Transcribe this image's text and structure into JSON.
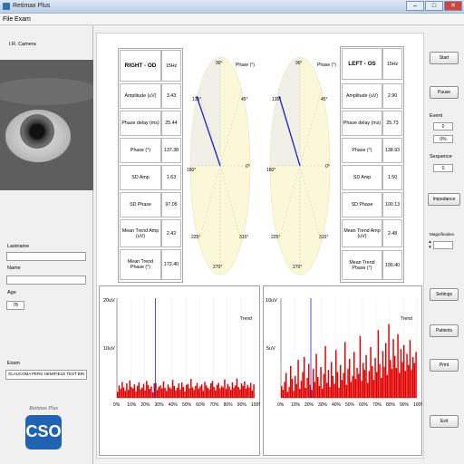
{
  "window": {
    "title": "Retimax Plus",
    "min": "–",
    "max": "□",
    "close": "✕"
  },
  "menu": [
    "File",
    "Exam"
  ],
  "left": {
    "camera_label": "I.R. Camera",
    "lastname_label": "Lastname",
    "lastname_value": "",
    "name_label": "Name",
    "name_value": "",
    "age_label": "Age",
    "age_value": "78",
    "exam_label": "Exam",
    "exam_value": "GLAUCOMA PERG HEMIFIELD TEST BIN",
    "brand": "Retimax Plus",
    "logo_text": "CSO"
  },
  "right_table": {
    "header_eye": "RIGHT - OD",
    "header_freq": "15Hz",
    "rows": [
      {
        "label": "Amplitude (uV)",
        "value": "3.43"
      },
      {
        "label": "Phase delay (ms)",
        "value": "25.44"
      },
      {
        "label": "Phase (°)",
        "value": "137.38"
      },
      {
        "label": "SD Amp",
        "value": "1.63"
      },
      {
        "label": "SD Phase",
        "value": "97.05"
      },
      {
        "label": "Mean Trend Amp (uV)",
        "value": "2.42"
      },
      {
        "label": "Mean Trend Phase (°)",
        "value": "172.40"
      }
    ]
  },
  "left_table": {
    "header_eye": "LEFT - OS",
    "header_freq": "15Hz",
    "rows": [
      {
        "label": "Amplitude (uV)",
        "value": "2.90"
      },
      {
        "label": "Phase delay (ms)",
        "value": "25.73"
      },
      {
        "label": "Phase (°)",
        "value": "138.93"
      },
      {
        "label": "SD Amp",
        "value": "1.50"
      },
      {
        "label": "SD Phase",
        "value": "100.13"
      },
      {
        "label": "Mean Trend Amp (uV)",
        "value": "2.48"
      },
      {
        "label": "Mean Trend Phase (°)",
        "value": "190.40"
      }
    ]
  },
  "polar_labels": {
    "title": "Phase (°)",
    "a90": "90°",
    "a45": "45°",
    "a0": "0°",
    "a315": "315°",
    "a270": "270°",
    "a225": "225°",
    "a180": "180°",
    "a135": "135°"
  },
  "buttons": {
    "start": "Start",
    "pause": "Pause",
    "impedance": "Impedance",
    "settings": "Settings",
    "patients": "Patients",
    "print": "Print",
    "exit": "Exit"
  },
  "status": {
    "event_label": "Event",
    "event_value": "0",
    "event_percent": "0%",
    "sequence_label": "Sequence",
    "sequence_value": "0",
    "magnification_label": "Magnification",
    "magnification_value": ""
  },
  "trend_labels": {
    "right": {
      "y_top": "20uV",
      "y_mid": "10uV",
      "trend": "Trend"
    },
    "left": {
      "y_top": "10uV",
      "y_mid": "5uV",
      "trend": "Trend"
    },
    "x_ticks": [
      "0%",
      "10%",
      "20%",
      "30%",
      "40%",
      "50%",
      "60%",
      "70%",
      "80%",
      "90%",
      "100%"
    ]
  },
  "colors": {
    "polar_fill": "#fbf8d8",
    "phase_vector": "#1a20c8",
    "trend_bar": "#e00000",
    "cursor": "#2222cc",
    "logo_blue": "#1f63b2"
  },
  "chart_data": [
    {
      "type": "polar",
      "name": "RIGHT - OD phase",
      "phase_deg": 137.38,
      "amplitude_uV": 3.43
    },
    {
      "type": "polar",
      "name": "LEFT - OS phase",
      "phase_deg": 138.93,
      "amplitude_uV": 2.9
    },
    {
      "type": "bar",
      "name": "RIGHT - OD trend",
      "x_range": [
        0,
        100
      ],
      "ylim": [
        0,
        20
      ],
      "cursor_x": 28,
      "values": [
        1.2,
        2.5,
        1.8,
        3.2,
        2.1,
        1.4,
        2.9,
        1.6,
        3.5,
        2.2,
        1.9,
        2.7,
        1.3,
        2.4,
        3.1,
        1.7,
        2.0,
        2.8,
        1.5,
        3.4,
        2.6,
        1.8,
        2.3,
        1.1,
        2.9,
        3.0,
        1.6,
        2.2,
        2.5,
        1.9,
        3.3,
        2.0,
        1.4,
        2.7,
        2.1,
        1.8,
        3.6,
        2.4,
        1.5,
        2.0,
        2.9,
        1.7,
        3.1,
        2.2,
        1.3,
        2.6,
        2.8,
        1.9,
        3.8,
        2.1,
        1.6,
        2.4,
        3.0,
        1.8,
        2.3,
        2.7,
        1.4,
        3.2,
        2.5,
        2.0,
        1.7,
        2.9,
        3.4,
        2.2,
        1.5,
        2.6,
        3.0,
        1.9,
        2.4,
        2.1,
        3.7,
        1.8,
        2.8,
        2.3,
        1.6,
        3.1,
        2.0,
        2.5,
        3.9,
        2.2,
        1.7,
        2.9,
        2.4,
        3.3,
        1.9,
        2.6,
        2.1,
        3.0,
        1.5,
        2.7
      ]
    },
    {
      "type": "bar",
      "name": "LEFT - OS trend",
      "x_range": [
        0,
        100
      ],
      "ylim": [
        0,
        10
      ],
      "cursor_x": 22,
      "values": [
        1.2,
        0.8,
        1.6,
        2.5,
        0.6,
        1.1,
        3.2,
        1.9,
        0.7,
        2.2,
        1.4,
        3.8,
        0.9,
        1.7,
        2.6,
        4.1,
        1.0,
        2.0,
        3.4,
        1.3,
        0.8,
        2.9,
        1.6,
        4.4,
        2.1,
        1.2,
        3.1,
        0.9,
        2.4,
        5.2,
        1.5,
        2.8,
        1.1,
        3.6,
        2.2,
        1.4,
        4.8,
        2.6,
        1.0,
        3.3,
        1.8,
        2.5,
        5.6,
        1.3,
        2.9,
        3.9,
        1.6,
        2.2,
        4.6,
        1.9,
        3.0,
        2.4,
        6.2,
        1.7,
        3.5,
        2.8,
        4.3,
        1.5,
        2.7,
        5.1,
        3.2,
        1.8,
        4.0,
        2.6,
        6.8,
        3.4,
        2.0,
        4.7,
        3.1,
        5.5,
        2.3,
        7.4,
        3.8,
        2.9,
        5.9,
        4.2,
        3.0,
        6.4,
        2.5,
        4.9,
        3.6,
        5.3,
        2.7,
        4.4,
        3.3,
        5.8,
        2.8,
        4.1,
        3.5,
        4.6
      ]
    }
  ]
}
